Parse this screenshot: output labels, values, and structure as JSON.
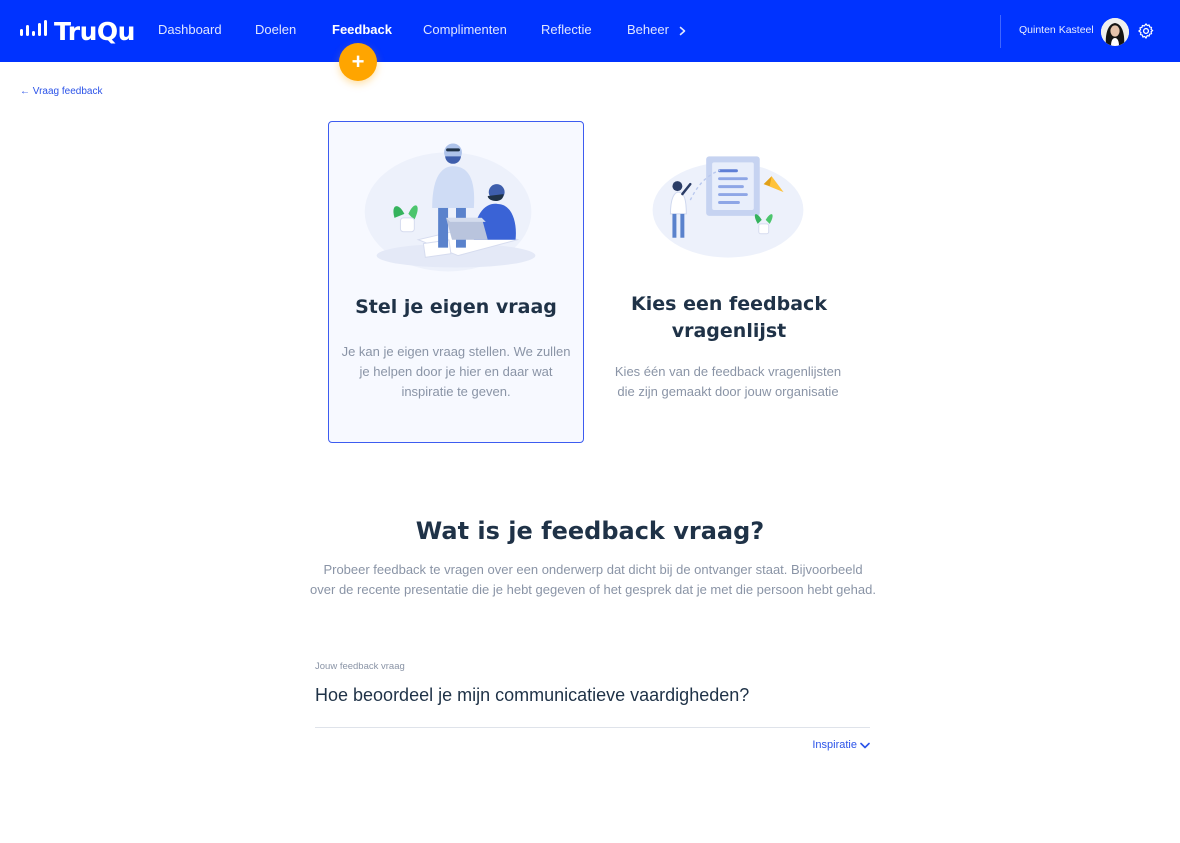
{
  "app": {
    "logo_text": "TruQu",
    "brand_color": "#0033ff",
    "accent_color": "#ffa500"
  },
  "nav": {
    "items": [
      {
        "label": "Dashboard",
        "active": false
      },
      {
        "label": "Doelen",
        "active": false
      },
      {
        "label": "Feedback",
        "active": true
      },
      {
        "label": "Complimenten",
        "active": false
      },
      {
        "label": "Reflectie",
        "active": false
      },
      {
        "label": "Beheer",
        "active": false,
        "has_chevron": true
      }
    ],
    "fab_label": "+"
  },
  "user": {
    "name": "Quinten Kasteel",
    "settings_icon": "gear-icon"
  },
  "breadcrumb": {
    "back_label": "← Vraag feedback"
  },
  "cards": [
    {
      "title": "Stel je eigen vraag",
      "description": "Je kan je eigen vraag stellen. We zullen je helpen door je hier en daar wat inspiratie te geven.",
      "selected": true
    },
    {
      "title": "Kies een feedback vragenlijst",
      "description": "Kies één van de feedback vragenlijsten die zijn gemaakt door jouw organisatie",
      "selected": false
    }
  ],
  "section": {
    "title": "Wat is je feedback vraag?",
    "description": "Probeer feedback te vragen over een onderwerp dat dicht bij de ontvanger staat. Bijvoorbeeld over de recente presentatie die je hebt gegeven of het gesprek dat je met die persoon hebt gehad."
  },
  "question_field": {
    "label": "Jouw feedback vraag",
    "value": "Hoe beoordeel je mijn communicatieve vaardigheden?"
  },
  "inspiration": {
    "label": "Inspiratie"
  }
}
